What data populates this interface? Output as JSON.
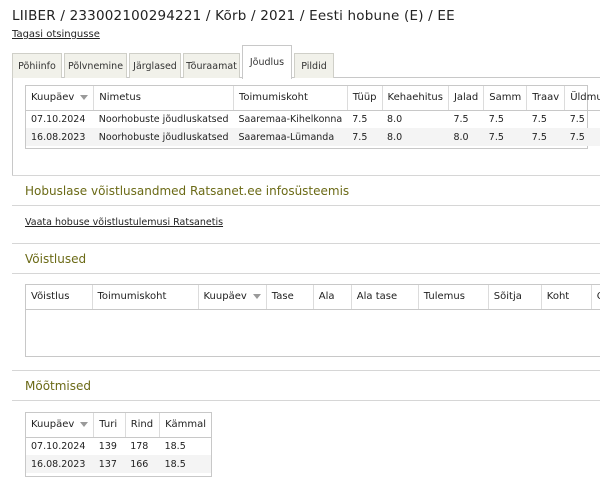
{
  "header": {
    "title": "LIIBER / 233002100294221 / Kõrb / 2021 / Eesti hobune (E) / EE",
    "back_link": "Tagasi otsingusse"
  },
  "tabs": [
    {
      "label": "Põhiinfo",
      "active": false
    },
    {
      "label": "Põlvnemine",
      "active": false
    },
    {
      "label": "Järglased",
      "active": false
    },
    {
      "label": "Tõuraamat",
      "active": false
    },
    {
      "label": "Jõudlus",
      "active": true
    },
    {
      "label": "Pildid",
      "active": false
    }
  ],
  "performance_table": {
    "columns": [
      "Kuupäev",
      "Nimetus",
      "Toimumiskoht",
      "Tüüp",
      "Kehaehitus",
      "Jalad",
      "Samm",
      "Traav",
      "Üldmulje"
    ],
    "rows": [
      [
        "07.10.2024",
        "Noorhobuste jõudluskatsed",
        "Saaremaa-Kihelkonna",
        "7.5",
        "8.0",
        "7.5",
        "7.5",
        "7.5",
        "7.5"
      ],
      [
        "16.08.2023",
        "Noorhobuste jõudluskatsed",
        "Saaremaa-Lümanda",
        "7.5",
        "8.0",
        "8.0",
        "7.5",
        "7.5",
        "7.5"
      ]
    ]
  },
  "ratsanet": {
    "title": "Hobuslase võistlusandmed Ratsanet.ee infosüsteemis",
    "link": "Vaata hobuse võistlustulemusi Ratsanetis"
  },
  "competitions": {
    "title": "Võistlused",
    "columns": [
      "Võistlus",
      "Toimumiskoht",
      "Kuupäev",
      "Tase",
      "Ala",
      "Ala tase",
      "Tulemus",
      "Sõitja",
      "Koht",
      "Os"
    ]
  },
  "measurements": {
    "title": "Mõõtmised",
    "columns": [
      "Kuupäev",
      "Turi",
      "Rind",
      "Kämmal"
    ],
    "rows": [
      [
        "07.10.2024",
        "139",
        "178",
        "18.5"
      ],
      [
        "16.08.2023",
        "137",
        "166",
        "18.5"
      ]
    ]
  }
}
